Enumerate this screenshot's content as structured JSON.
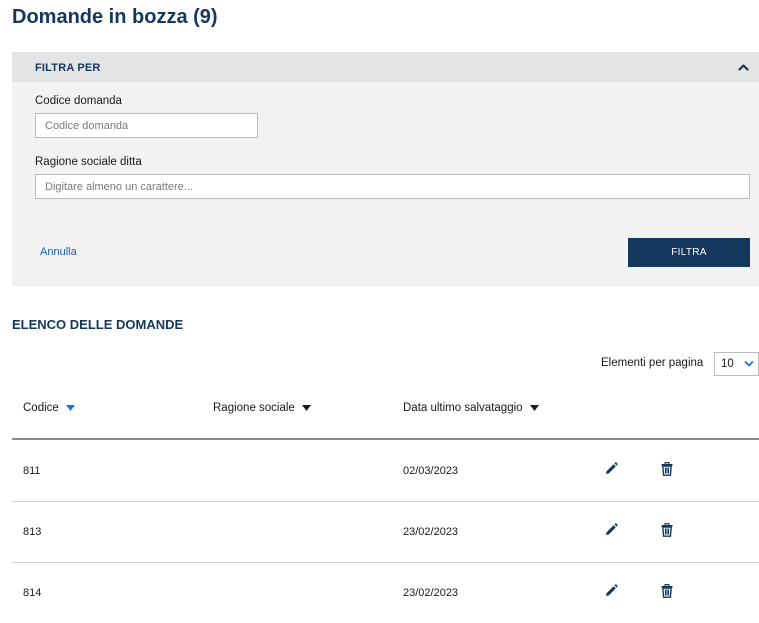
{
  "page": {
    "title": "Domande in bozza (9)"
  },
  "filter": {
    "title": "FILTRA PER",
    "codice_label": "Codice domanda",
    "codice_placeholder": "Codice domanda",
    "ragione_label": "Ragione sociale ditta",
    "ragione_placeholder": "Digitare almeno un carattere...",
    "cancel_label": "Annulla",
    "submit_label": "FILTRA"
  },
  "list": {
    "title": "ELENCO DELLE DOMANDE",
    "per_page_label": "Elementi per pagina",
    "per_page_value": "10",
    "columns": [
      {
        "label": "Codice",
        "sort_icon": "caret-down-icon",
        "active": true
      },
      {
        "label": "Ragione sociale",
        "sort_icon": "caret-down-icon",
        "active": false
      },
      {
        "label": "Data ultimo salvataggio",
        "sort_icon": "caret-down-icon",
        "active": false
      }
    ],
    "rows": [
      {
        "codice": "811",
        "ragione_sociale": "",
        "data": "02/03/2023"
      },
      {
        "codice": "813",
        "ragione_sociale": "",
        "data": "23/02/2023"
      },
      {
        "codice": "814",
        "ragione_sociale": "",
        "data": "23/02/2023"
      }
    ]
  },
  "colors": {
    "brand": "#14375e",
    "link": "#1a5fb4",
    "sort_active": "#1a73e8",
    "panel_bg": "#f2f2f2",
    "panel_header_bg": "#e3e4e6"
  },
  "icons": {
    "collapse": "chevron-up-icon",
    "select": "chevron-down-icon",
    "edit": "pencil-icon",
    "delete": "trash-icon"
  }
}
